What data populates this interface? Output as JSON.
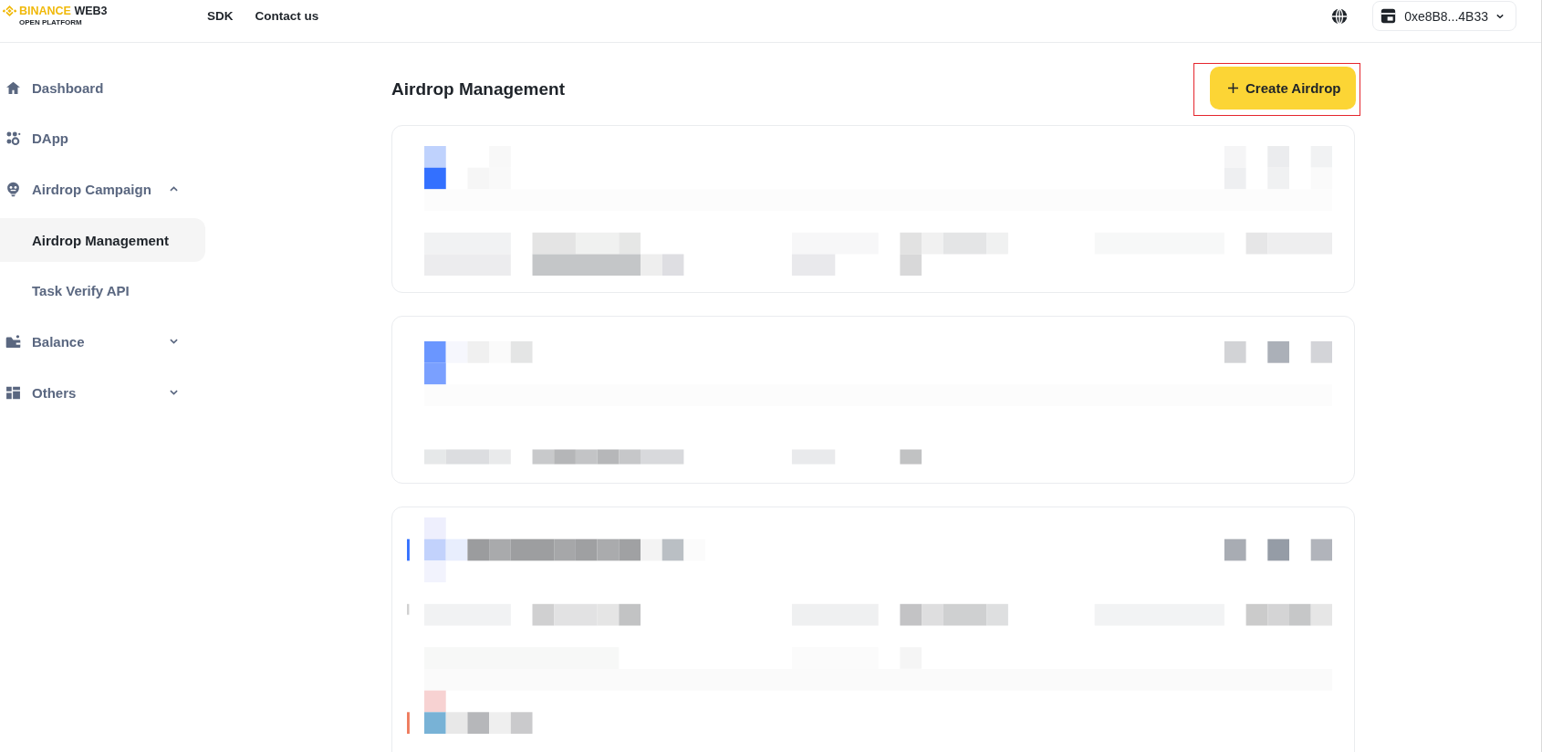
{
  "header": {
    "logo": {
      "brand": "BINANCE",
      "product": "WEB3",
      "subtitle": "OPEN PLATFORM"
    },
    "nav": [
      "SDK",
      "Contact us"
    ],
    "wallet": {
      "address": "0xe8B8...4B33"
    }
  },
  "sidebar": {
    "items": [
      {
        "label": "Dashboard",
        "selected": false
      },
      {
        "label": "DApp",
        "selected": false
      },
      {
        "label": "Airdrop Campaign",
        "selected": false,
        "expanded": true,
        "children": [
          {
            "label": "Airdrop Management",
            "selected": true
          },
          {
            "label": "Task Verify API",
            "selected": false
          }
        ]
      },
      {
        "label": "Balance",
        "selected": false,
        "expanded": false
      },
      {
        "label": "Others",
        "selected": false,
        "expanded": false
      }
    ]
  },
  "main": {
    "title": "Airdrop Management",
    "create_button": {
      "label": "Create Airdrop",
      "highlighted": true
    },
    "airdrop_cards": [
      {
        "kind": "pixelated"
      },
      {
        "kind": "pixelated"
      },
      {
        "kind": "pixelated"
      }
    ]
  }
}
